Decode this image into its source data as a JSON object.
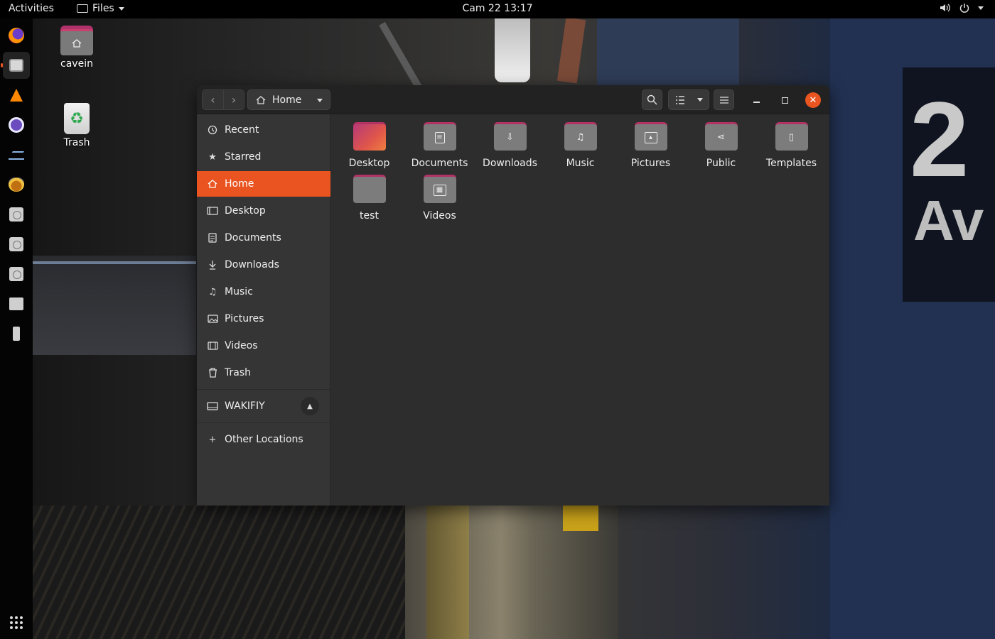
{
  "topbar": {
    "activities": "Activities",
    "app_menu": "Files",
    "clock": "Cam 22  13:17",
    "volume_icon": "volume-icon",
    "power_icon": "power-icon"
  },
  "dock": {
    "items": [
      "firefox-icon",
      "files-icon",
      "vlc-icon",
      "github-desktop-icon",
      "system-monitor-icon",
      "transmission-icon",
      "disk-icon",
      "disk-icon",
      "disk-icon",
      "ssd-icon",
      "usb-icon"
    ],
    "show_apps": "show-applications-icon"
  },
  "desktop": {
    "icons": [
      {
        "label": "cavein",
        "icon": "home-folder-icon"
      },
      {
        "label": "Trash",
        "icon": "trash-icon"
      }
    ]
  },
  "window": {
    "path_label": "Home",
    "sidebar": {
      "items": [
        {
          "label": "Recent",
          "icon": "clock-icon"
        },
        {
          "label": "Starred",
          "icon": "star-icon"
        },
        {
          "label": "Home",
          "icon": "home-icon",
          "selected": true
        },
        {
          "label": "Desktop",
          "icon": "desktop-icon"
        },
        {
          "label": "Documents",
          "icon": "document-icon"
        },
        {
          "label": "Downloads",
          "icon": "download-icon"
        },
        {
          "label": "Music",
          "icon": "music-icon"
        },
        {
          "label": "Pictures",
          "icon": "picture-icon"
        },
        {
          "label": "Videos",
          "icon": "video-icon"
        },
        {
          "label": "Trash",
          "icon": "trash-icon"
        }
      ],
      "device": {
        "label": "WAKIFIY",
        "icon": "drive-icon"
      },
      "other_locations": "Other Locations"
    },
    "files": [
      {
        "label": "Desktop",
        "icon": "desktop-folder-icon"
      },
      {
        "label": "Documents",
        "icon": "documents-folder-icon"
      },
      {
        "label": "Downloads",
        "icon": "downloads-folder-icon"
      },
      {
        "label": "Music",
        "icon": "music-folder-icon"
      },
      {
        "label": "Pictures",
        "icon": "pictures-folder-icon"
      },
      {
        "label": "Public",
        "icon": "public-folder-icon"
      },
      {
        "label": "Templates",
        "icon": "templates-folder-icon"
      },
      {
        "label": "test",
        "icon": "folder-icon"
      },
      {
        "label": "Videos",
        "icon": "videos-folder-icon"
      }
    ]
  },
  "wallpaper": {
    "sign_number": "2",
    "sign_text": "Av"
  },
  "colors": {
    "accent": "#e95420",
    "folder_tab": "#b13263",
    "folder_body": "#7c7c7c",
    "window_bg": "#2d2d2d",
    "sidebar_bg": "#353535"
  }
}
